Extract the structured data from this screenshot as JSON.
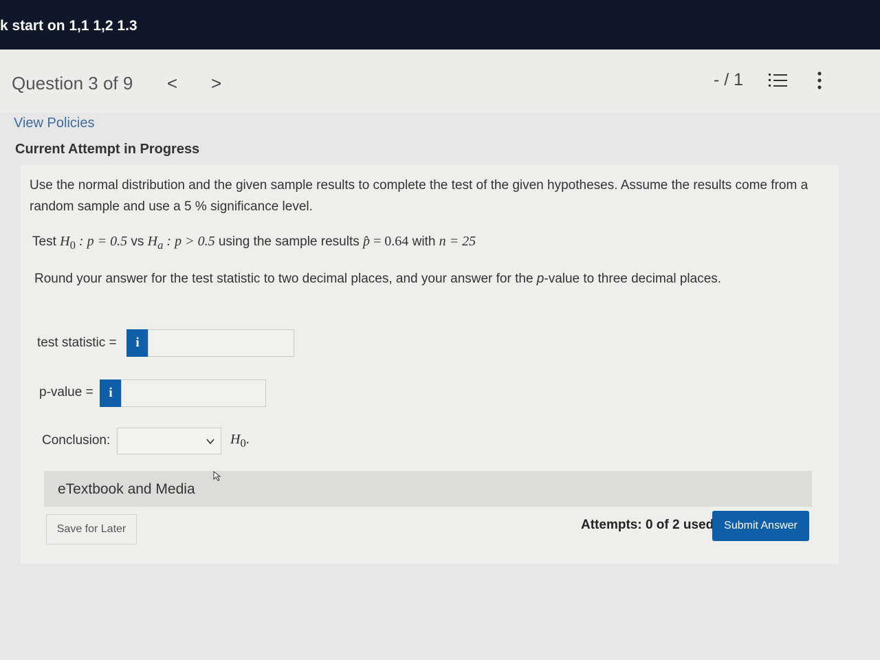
{
  "header": {
    "title_fragment": "k start on 1,1 1,2 1.3"
  },
  "nav": {
    "question_label": "Question 3 of 9",
    "prev_symbol": "<",
    "next_symbol": ">",
    "score": "- / 1"
  },
  "policies_link": "View Policies",
  "attempt_status": "Current Attempt in Progress",
  "question": {
    "intro": "Use the normal distribution and the given sample results to complete the test of the given hypotheses. Assume the results come from a random sample and use a 5 % significance level.",
    "test_prefix": "Test",
    "h0": "H",
    "h0_sub": "0",
    "h0_rel": " : p = 0.5",
    "vs": " vs ",
    "ha": "H",
    "ha_sub": "a",
    "ha_rel": " : p > 0.5",
    "using_text": " using the sample results ",
    "phat": "p̂",
    "phat_val": " = 0.64",
    "with_text": " with ",
    "n_text": "n = 25",
    "round_instruction_1": "Round your answer for the test statistic to two decimal places, and your answer for the ",
    "round_p": "p",
    "round_instruction_2": "-value to three decimal places."
  },
  "fields": {
    "test_statistic_label": "test statistic =",
    "test_statistic_value": "",
    "pvalue_label": "p-value =",
    "pvalue_value": "",
    "info_symbol": "i",
    "conclusion_label": "Conclusion:",
    "conclusion_selected": "",
    "conclusion_suffix_h": "H",
    "conclusion_suffix_sub": "0",
    "conclusion_suffix_end": "."
  },
  "etextbook_label": "eTextbook and Media",
  "save_label": "Save for Later",
  "attempts_text": "Attempts: 0 of 2 used",
  "submit_label": "Submit Answer",
  "colors": {
    "topbar": "#0f1729",
    "accent": "#0f5ea8",
    "link": "#3f6c99"
  }
}
